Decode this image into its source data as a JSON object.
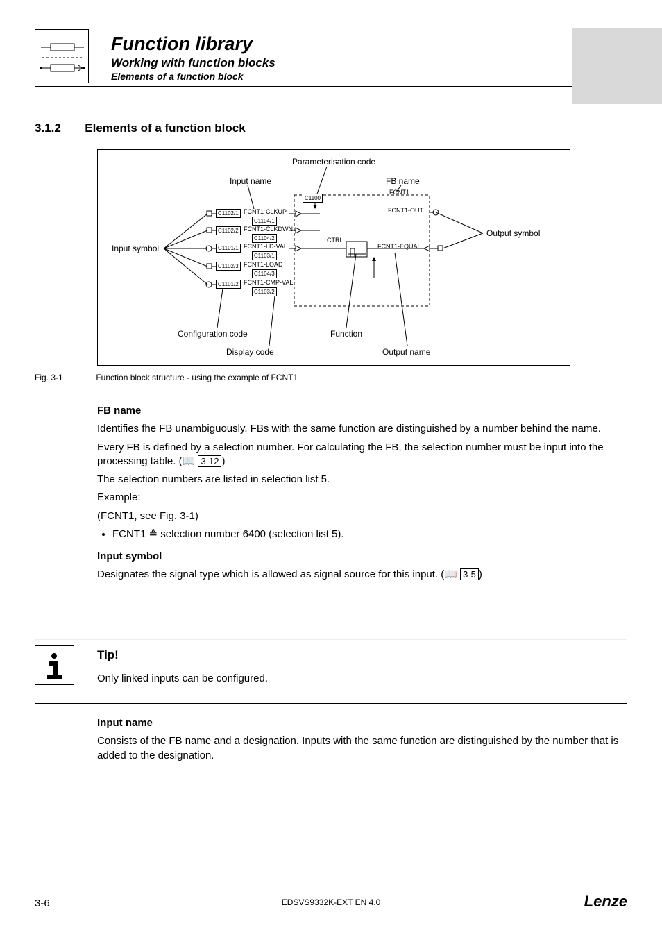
{
  "header": {
    "title": "Function library",
    "subtitle": "Working with function blocks",
    "subsubtitle": "Elements of a function block"
  },
  "section": {
    "number": "3.1.2",
    "title": "Elements of a function block"
  },
  "diagram": {
    "labels": {
      "parameterisation_code": "Parameterisation code",
      "input_name": "Input name",
      "fb_name": "FB name",
      "output_symbol": "Output symbol",
      "input_symbol": "Input symbol",
      "configuration_code": "Configuration code",
      "display_code": "Display code",
      "function": "Function",
      "output_name": "Output name",
      "ctrl": "CTRL"
    },
    "fb_title": "FCNT1",
    "param_code_box": "C1100",
    "outputs": {
      "out": "FCNT1-OUT",
      "equal": "FCNT1-EQUAL"
    },
    "rows": [
      {
        "cfg": "C1102/1",
        "name": "FCNT1-CLKUP",
        "disp": "C1104/1"
      },
      {
        "cfg": "C1102/2",
        "name": "FCNT1-CLKDWN",
        "disp": "C1104/2"
      },
      {
        "cfg": "C1101/1",
        "name": "FCNT1-LD-VAL",
        "disp": "C1103/1"
      },
      {
        "cfg": "C1102/3",
        "name": "FCNT1-LOAD",
        "disp": "C1104/3"
      },
      {
        "cfg": "C1101/2",
        "name": "FCNT1-CMP-VAL",
        "disp": "C1103/2"
      }
    ]
  },
  "figure": {
    "num": "Fig. 3-1",
    "caption": "Function block structure - using the example of FCNT1"
  },
  "body": {
    "fb_name_h": "FB name",
    "fb_name_p1": "Identifies fhe FB unambiguously. FBs with the same function are distinguished by a number behind the name.",
    "fb_name_p2a": "Every FB is defined by a selection number. For calculating the FB, the selection number must be input into the processing table. (",
    "fb_name_p2_ref": "3-12",
    "fb_name_p2b": ")",
    "fb_name_p3": "The selection numbers are listed in selection list 5.",
    "example_label": "Example:",
    "example_line": "(FCNT1, see Fig. 3-1)",
    "bullet1": "FCNT1 ≙ selection number 6400 (selection list 5).",
    "input_symbol_h": "Input symbol",
    "input_symbol_p_a": "Designates the signal type which is allowed as signal source for this input. (",
    "input_symbol_ref": "3-5",
    "input_symbol_p_b": ")"
  },
  "tip": {
    "heading": "Tip!",
    "text": "Only linked  inputs can be configured."
  },
  "after_tip": {
    "input_name_h": "Input name",
    "input_name_p": "Consists of the FB name and a designation. Inputs with the same function are distinguished by the number that is added to the designation."
  },
  "footer": {
    "page": "3-6",
    "doc_id": "EDSVS9332K-EXT EN 4.0",
    "brand": "Lenze"
  },
  "icons": {
    "book": "📖"
  }
}
